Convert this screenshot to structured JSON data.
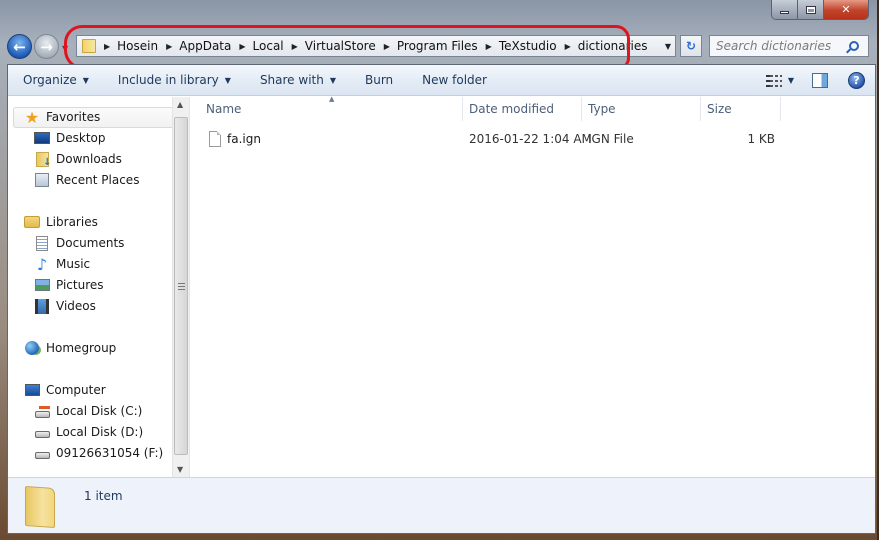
{
  "window": {
    "caption_buttons": {
      "minimize": "minimize",
      "maximize": "maximize",
      "close": "close"
    }
  },
  "navigation": {
    "back_icon": "←",
    "forward_icon": "→",
    "breadcrumbs": [
      "Hosein",
      "AppData",
      "Local",
      "VirtualStore",
      "Program Files",
      "TeXstudio",
      "dictionaries"
    ],
    "search_placeholder": "Search dictionaries",
    "refresh_icon": "↻"
  },
  "toolbar": {
    "organize": "Organize",
    "include_in_library": "Include in library",
    "share_with": "Share with",
    "burn": "Burn",
    "new_folder": "New folder",
    "help": "?"
  },
  "sidebar": {
    "favorites": {
      "label": "Favorites",
      "items": [
        "Desktop",
        "Downloads",
        "Recent Places"
      ]
    },
    "libraries": {
      "label": "Libraries",
      "items": [
        "Documents",
        "Music",
        "Pictures",
        "Videos"
      ]
    },
    "homegroup": {
      "label": "Homegroup"
    },
    "computer": {
      "label": "Computer",
      "items": [
        "Local Disk (C:)",
        "Local Disk (D:)",
        "09126631054 (F:)"
      ]
    }
  },
  "file_list": {
    "columns": [
      "Name",
      "Date modified",
      "Type",
      "Size"
    ],
    "rows": [
      {
        "name": "fa.ign",
        "date_modified": "2016-01-22 1:04 AM",
        "type": "IGN File",
        "size": "1 KB"
      }
    ]
  },
  "details_pane": {
    "item_count": "1 item"
  },
  "colors": {
    "highlight_ring": "#e0141c",
    "command_text": "#1e395b"
  }
}
